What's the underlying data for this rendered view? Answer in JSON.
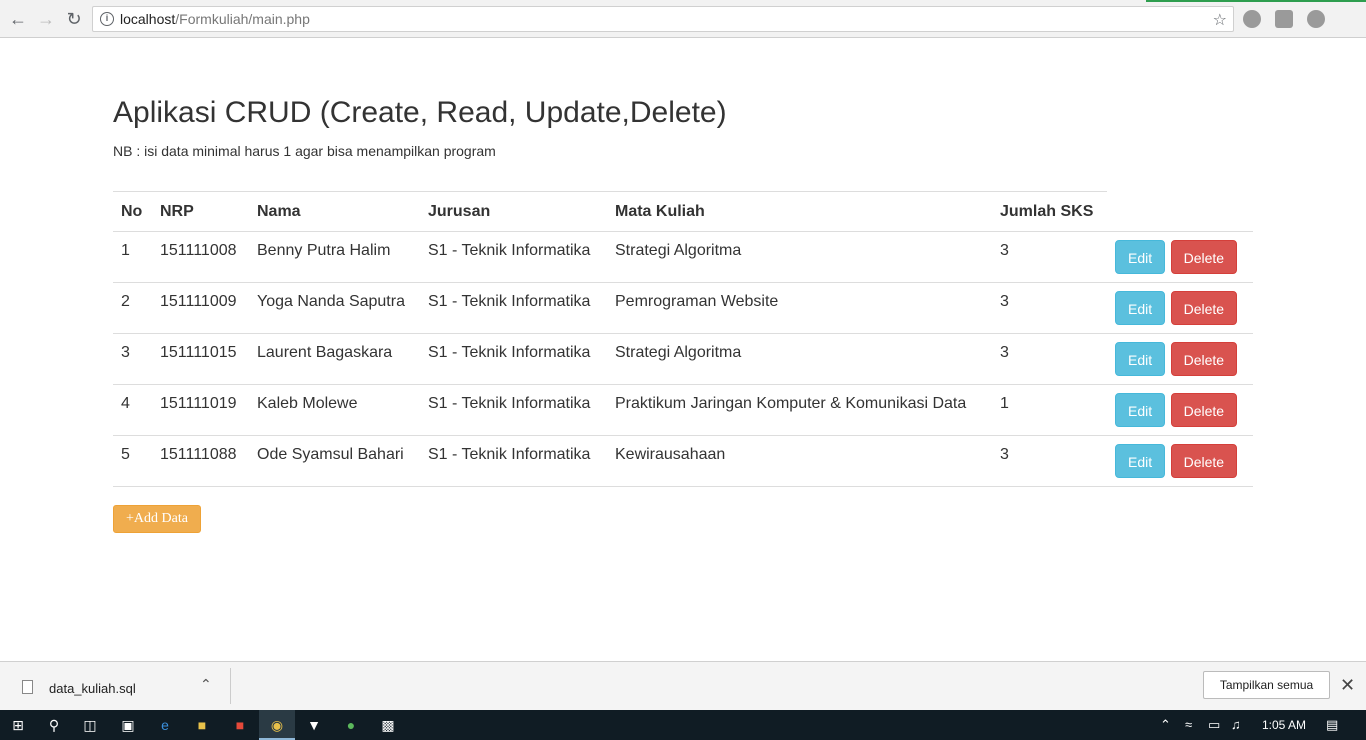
{
  "browser": {
    "url_host": "localhost",
    "url_path": "/Formkuliah/main.php"
  },
  "page": {
    "title": "Aplikasi CRUD (Create, Read, Update,Delete)",
    "note": "NB : isi data minimal harus 1 agar bisa menampilkan program",
    "add_button": "+Add Data",
    "edit_label": "Edit",
    "delete_label": "Delete"
  },
  "table": {
    "headers": [
      "No",
      "NRP",
      "Nama",
      "Jurusan",
      "Mata Kuliah",
      "Jumlah SKS"
    ],
    "rows": [
      [
        "1",
        "151111008",
        "Benny Putra Halim",
        "S1 - Teknik Informatika",
        "Strategi Algoritma",
        "3"
      ],
      [
        "2",
        "151111009",
        "Yoga Nanda Saputra",
        "S1 - Teknik Informatika",
        "Pemrograman Website",
        "3"
      ],
      [
        "3",
        "151111015",
        "Laurent Bagaskara",
        "S1 - Teknik Informatika",
        "Strategi Algoritma",
        "3"
      ],
      [
        "4",
        "151111019",
        "Kaleb Molewe",
        "S1 - Teknik Informatika",
        "Praktikum Jaringan Komputer & Komunikasi Data",
        "1"
      ],
      [
        "5",
        "151111088",
        "Ode Syamsul Bahari",
        "S1 - Teknik Informatika",
        "Kewirausahaan",
        "3"
      ]
    ]
  },
  "download_bar": {
    "file_name": "data_kuliah.sql",
    "show_all": "Tampilkan semua"
  },
  "taskbar": {
    "clock": "1:05 AM"
  },
  "colors": {
    "edit": "#5bc0de",
    "delete": "#d9534f",
    "add": "#f0ad4e"
  }
}
